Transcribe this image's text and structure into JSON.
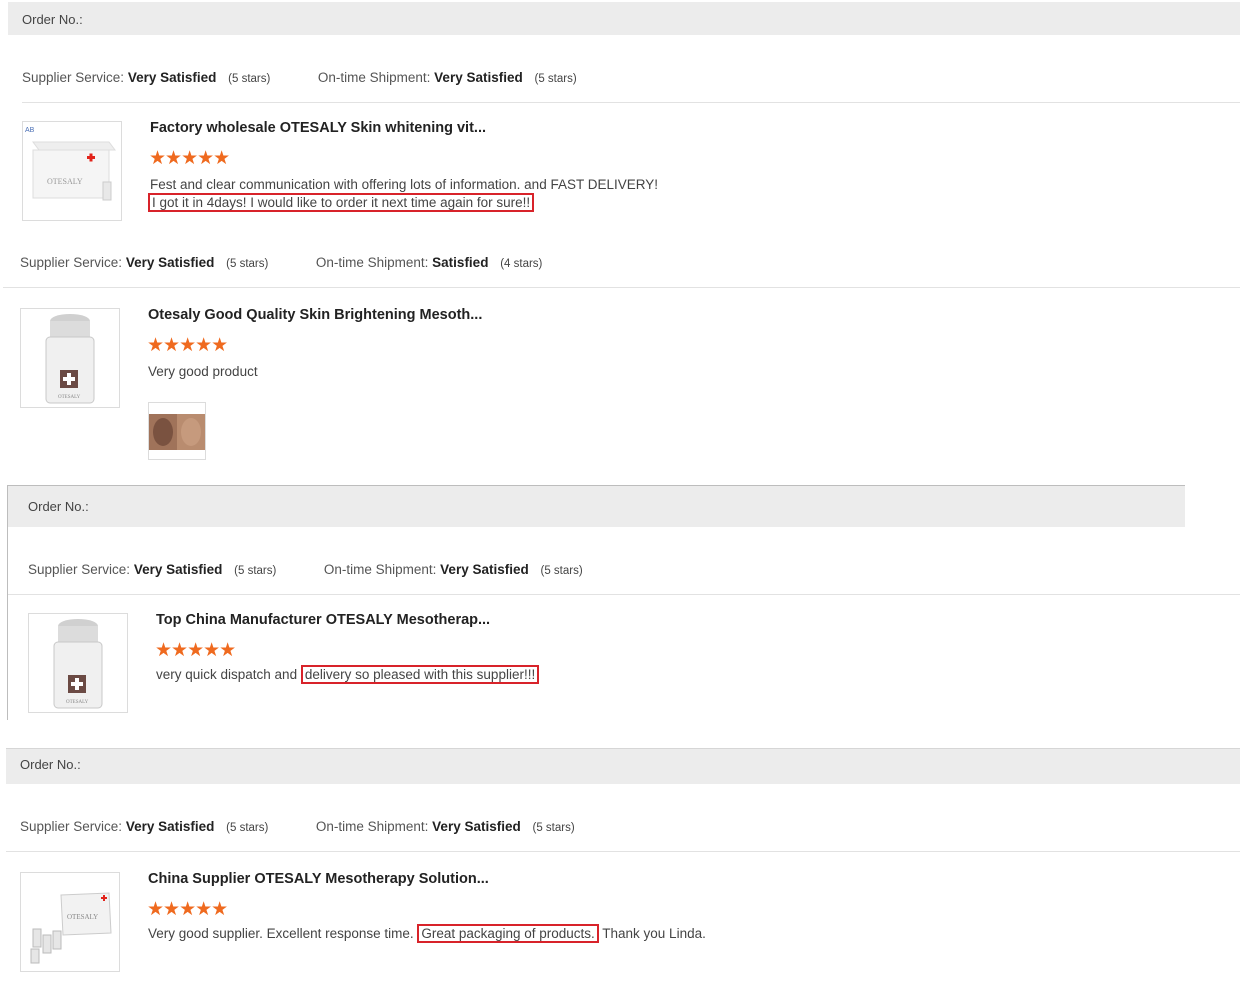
{
  "reviews": [
    {
      "order_label": "Order No.:",
      "supplier_label": "Supplier Service:",
      "supplier_value": "Very Satisfied",
      "supplier_stars": "(5 stars)",
      "shipment_label": "On-time Shipment:",
      "shipment_value": "Very Satisfied",
      "shipment_stars": "(5 stars)",
      "product_title": "Factory wholesale OTESALY Skin whitening vit...",
      "rating": "★★★★★",
      "comment_line1": "Fest and clear communication with offering lots of information. and FAST DELIVERY!",
      "comment_line2": "I got it in 4days! I would like to order it next time again for sure!!"
    },
    {
      "supplier_label": "Supplier Service:",
      "supplier_value": "Very Satisfied",
      "supplier_stars": "(5 stars)",
      "shipment_label": "On-time Shipment:",
      "shipment_value": "Satisfied",
      "shipment_stars": "(4 stars)",
      "product_title": "Otesaly Good Quality Skin Brightening Mesoth...",
      "rating": "★★★★★",
      "comment": "Very good product"
    },
    {
      "order_label": "Order No.:",
      "supplier_label": "Supplier Service:",
      "supplier_value": "Very Satisfied",
      "supplier_stars": "(5 stars)",
      "shipment_label": "On-time Shipment:",
      "shipment_value": "Very Satisfied",
      "shipment_stars": "(5 stars)",
      "product_title": "Top China Manufacturer OTESALY Mesotherap...",
      "rating": "★★★★★",
      "comment_pre": "very quick dispatch and ",
      "comment_boxed": "delivery so pleased with this supplier!!!"
    },
    {
      "order_label": "Order No.:",
      "supplier_label": "Supplier Service:",
      "supplier_value": "Very Satisfied",
      "supplier_stars": "(5 stars)",
      "shipment_label": "On-time Shipment:",
      "shipment_value": "Very Satisfied",
      "shipment_stars": "(5 stars)",
      "product_title": "China Supplier OTESALY Mesotherapy Solution...",
      "rating": "★★★★★",
      "comment_pre": "Very good supplier. Excellent response time. ",
      "comment_boxed": "Great packaging of products.",
      "comment_post": " Thank you Linda."
    }
  ],
  "colors": {
    "star": "#ef6a1f",
    "highlight_box": "#d8232a",
    "order_bar": "#ececec"
  },
  "icons": {
    "product_box": "product-box-image",
    "product_vial": "product-vial-image",
    "face_photo": "customer-photo"
  }
}
